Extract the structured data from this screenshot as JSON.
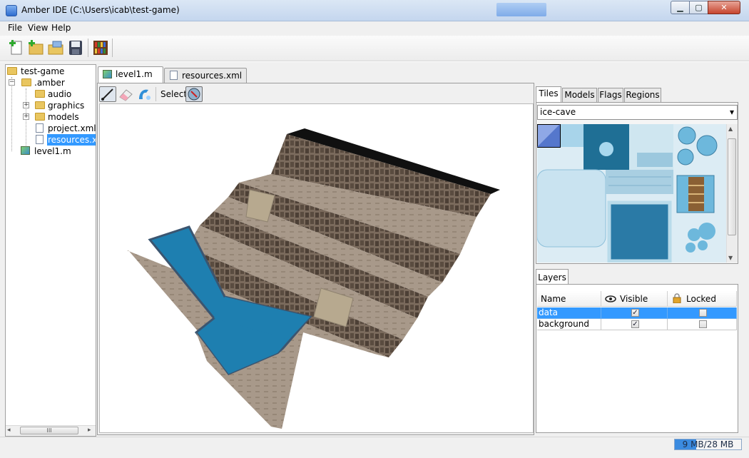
{
  "window": {
    "title": "Amber IDE (C:\\Users\\icab\\test-game)",
    "minimize_glyph": "▁",
    "maximize_glyph": "▢",
    "close_glyph": "✕"
  },
  "menu": {
    "file": "File",
    "view": "View",
    "help": "Help"
  },
  "tree": {
    "root": "test-game",
    "amber": ".amber",
    "audio": "audio",
    "graphics": "graphics",
    "models": "models",
    "project": "project.xml",
    "resources": "resources.xml",
    "level": "level1.m",
    "scroll_grip": "III"
  },
  "editor_tabs": [
    {
      "label": "level1.m",
      "close": "✕"
    },
    {
      "label": "resources.xml",
      "close": "✕"
    }
  ],
  "editor_tools": {
    "select_label": "Select"
  },
  "right_tabs": [
    "Tiles",
    "Models",
    "Flags",
    "Regions"
  ],
  "tileset": {
    "selected": "ice-cave",
    "arrow": "▾"
  },
  "layers": {
    "tab": "Layers",
    "headers": [
      "Name",
      "Visible",
      "Locked"
    ],
    "rows": [
      {
        "name": "data",
        "visible": "✓",
        "locked": ""
      },
      {
        "name": "background",
        "visible": "✓",
        "locked": ""
      }
    ]
  },
  "status": {
    "memory": "9 MB/28 MB",
    "memory_used_fraction": 0.32
  },
  "colors": {
    "selection": "#3399ff",
    "water": "#1e7fb0",
    "ground": "#a8998a"
  },
  "icons": [
    "new-project-icon",
    "new-file-icon",
    "open-icon",
    "save-icon",
    "library-icon",
    "brush-icon",
    "eraser-icon",
    "bucket-icon",
    "compass-icon",
    "eye-icon",
    "lock-icon"
  ]
}
